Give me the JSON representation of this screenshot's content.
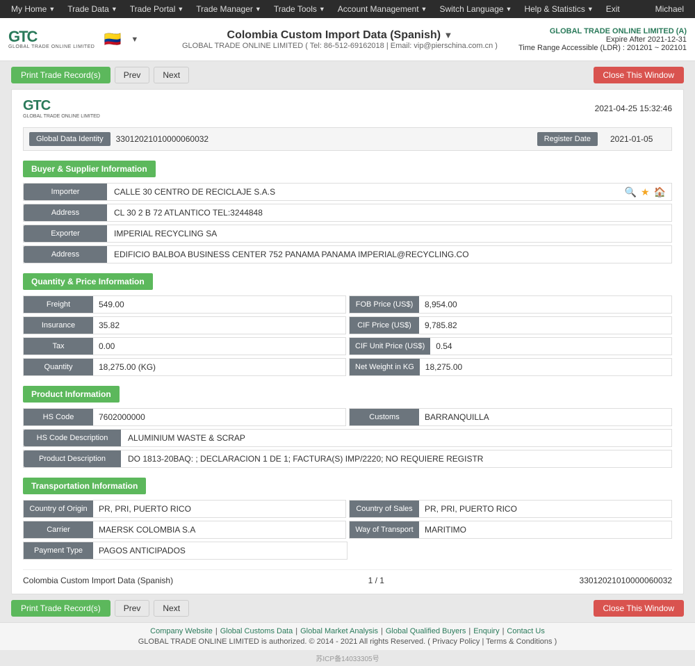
{
  "nav": {
    "items": [
      {
        "label": "My Home",
        "arrow": true
      },
      {
        "label": "Trade Data",
        "arrow": true
      },
      {
        "label": "Trade Portal",
        "arrow": true
      },
      {
        "label": "Trade Manager",
        "arrow": true
      },
      {
        "label": "Trade Tools",
        "arrow": true
      },
      {
        "label": "Account Management",
        "arrow": true
      },
      {
        "label": "Switch Language",
        "arrow": true
      },
      {
        "label": "Help & Statistics",
        "arrow": true
      },
      {
        "label": "Exit",
        "arrow": false
      }
    ],
    "user": "Michael"
  },
  "header": {
    "title": "Colombia Custom Import Data (Spanish)",
    "subtitle": "GLOBAL TRADE ONLINE LIMITED ( Tel: 86-512-69162018 | Email: vip@pierschina.com.cn )",
    "company": "GLOBAL TRADE ONLINE LIMITED (A)",
    "expire": "Expire After 2021-12-31",
    "time_range": "Time Range Accessible (LDR) : 201201 ~ 202101",
    "flag": "🇨🇴"
  },
  "toolbar": {
    "print_label": "Print Trade Record(s)",
    "prev_label": "Prev",
    "next_label": "Next",
    "close_label": "Close This Window"
  },
  "record": {
    "datetime": "2021-04-25 15:32:46",
    "global_data_identity_label": "Global Data Identity",
    "global_data_identity_value": "33012021010000060032",
    "register_date_label": "Register Date",
    "register_date_value": "2021-01-05"
  },
  "buyer_supplier": {
    "section_label": "Buyer & Supplier Information",
    "importer_label": "Importer",
    "importer_value": "CALLE 30 CENTRO DE RECICLAJE S.A.S",
    "address1_label": "Address",
    "address1_value": "CL 30 2 B 72 ATLANTICO TEL:3244848",
    "exporter_label": "Exporter",
    "exporter_value": "IMPERIAL RECYCLING SA",
    "address2_label": "Address",
    "address2_value": "EDIFICIO BALBOA BUSINESS CENTER 752 PANAMA PANAMA IMPERIAL@RECYCLING.CO"
  },
  "quantity_price": {
    "section_label": "Quantity & Price Information",
    "freight_label": "Freight",
    "freight_value": "549.00",
    "fob_label": "FOB Price (US$)",
    "fob_value": "8,954.00",
    "insurance_label": "Insurance",
    "insurance_value": "35.82",
    "cif_label": "CIF Price (US$)",
    "cif_value": "9,785.82",
    "tax_label": "Tax",
    "tax_value": "0.00",
    "cif_unit_label": "CIF Unit Price (US$)",
    "cif_unit_value": "0.54",
    "quantity_label": "Quantity",
    "quantity_value": "18,275.00 (KG)",
    "net_weight_label": "Net Weight in KG",
    "net_weight_value": "18,275.00"
  },
  "product": {
    "section_label": "Product Information",
    "hs_code_label": "HS Code",
    "hs_code_value": "7602000000",
    "customs_label": "Customs",
    "customs_value": "BARRANQUILLA",
    "hs_desc_label": "HS Code Description",
    "hs_desc_value": "ALUMINIUM WASTE & SCRAP",
    "prod_desc_label": "Product Description",
    "prod_desc_value": "DO 1813-20BAQ: ; DECLARACION 1 DE 1; FACTURA(S) IMP/2220; NO REQUIERE REGISTR"
  },
  "transportation": {
    "section_label": "Transportation Information",
    "country_origin_label": "Country of Origin",
    "country_origin_value": "PR, PRI, PUERTO RICO",
    "country_sales_label": "Country of Sales",
    "country_sales_value": "PR, PRI, PUERTO RICO",
    "carrier_label": "Carrier",
    "carrier_value": "MAERSK COLOMBIA S.A",
    "way_label": "Way of Transport",
    "way_value": "MARITIMO",
    "payment_label": "Payment Type",
    "payment_value": "PAGOS ANTICIPADOS"
  },
  "card_footer": {
    "left": "Colombia Custom Import Data (Spanish)",
    "center": "1 / 1",
    "right": "33012021010000060032"
  },
  "footer": {
    "links": [
      "Company Website",
      "Global Customs Data",
      "Global Market Analysis",
      "Global Qualified Buyers",
      "Enquiry",
      "Contact Us"
    ],
    "copyright": "GLOBAL TRADE ONLINE LIMITED is authorized. © 2014 - 2021 All rights Reserved.  ( Privacy Policy | Terms & Conditions )",
    "icp": "苏ICP备14033305号"
  }
}
